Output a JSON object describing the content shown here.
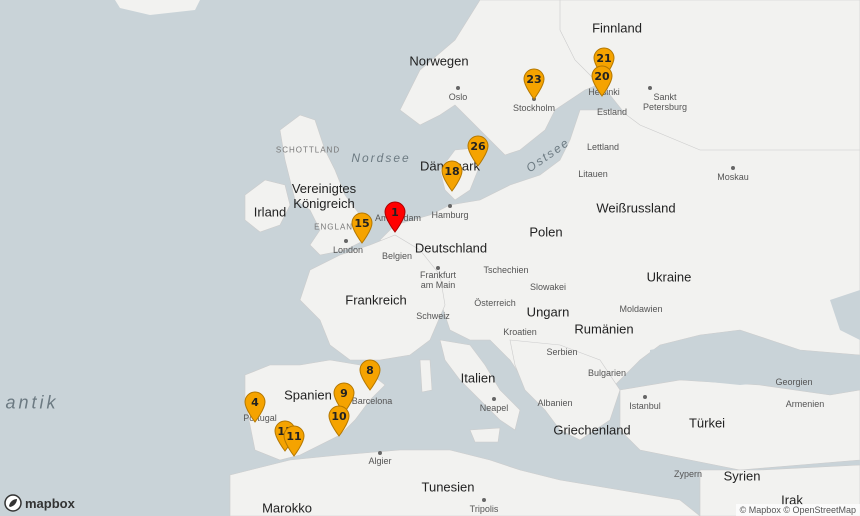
{
  "map": {
    "labels": {
      "finnland": "Finnland",
      "norwegen": "Norwegen",
      "oslo": "Oslo",
      "stockholm": "Stockholm",
      "helsinki": "Helsinki",
      "sankt_petersburg": "Sankt\nPetersburg",
      "estland": "Estland",
      "lettland": "Lettland",
      "litauen": "Litauen",
      "moskau": "Moskau",
      "schottland": "SCHOTTLAND",
      "nordsee": "Nordsee",
      "daenemark": "Dänemark",
      "ostsee": "Ostsee",
      "vereinigtes_koenigreich": "Vereinigtes\nKönigreich",
      "irland": "Irland",
      "england": "ENGLAND",
      "london": "London",
      "amsterdam": "Amsterdam",
      "hamburg": "Hamburg",
      "deutschland": "Deutschland",
      "polen": "Polen",
      "weissrussland": "Weißrussland",
      "belgien": "Belgien",
      "frankfurt": "Frankfurt\nam Main",
      "tschechien": "Tschechien",
      "slowakei": "Slowakei",
      "ukraine": "Ukraine",
      "frankreich": "Frankreich",
      "oesterreich": "Österreich",
      "schweiz": "Schweiz",
      "ungarn": "Ungarn",
      "moldawien": "Moldawien",
      "rumaenien": "Rumänien",
      "kroatien": "Kroatien",
      "serbien": "Serbien",
      "italien": "Italien",
      "bulgarien": "Bulgarien",
      "spanien": "Spanien",
      "barcelona": "Barcelona",
      "portugal": "Portugal",
      "atlantik": "antik",
      "neapel": "Neapel",
      "albanien": "Albanien",
      "istanbul": "Istanbul",
      "georgien": "Georgien",
      "armenien": "Armenien",
      "griechenland": "Griechenland",
      "tuerkei": "Türkei",
      "algier": "Algier",
      "tunesien": "Tunesien",
      "syrien": "Syrien",
      "zypern": "Zypern",
      "marokko": "Marokko",
      "tripolis": "Tripolis",
      "irak": "Irak"
    },
    "markers": [
      {
        "id": "m1",
        "label": "1",
        "color": "#ff0000"
      },
      {
        "id": "m4",
        "label": "4",
        "color": "#f5a300"
      },
      {
        "id": "m8",
        "label": "8",
        "color": "#f5a300"
      },
      {
        "id": "m9",
        "label": "9",
        "color": "#f5a300"
      },
      {
        "id": "m10",
        "label": "10",
        "color": "#f5a300"
      },
      {
        "id": "m11a",
        "label": "11",
        "color": "#f5a300"
      },
      {
        "id": "m11",
        "label": "11",
        "color": "#f5a300"
      },
      {
        "id": "m15",
        "label": "15",
        "color": "#f5a300"
      },
      {
        "id": "m18",
        "label": "18",
        "color": "#f5a300"
      },
      {
        "id": "m20",
        "label": "20",
        "color": "#f5a300"
      },
      {
        "id": "m21",
        "label": "21",
        "color": "#f5a300"
      },
      {
        "id": "m23",
        "label": "23",
        "color": "#f5a300"
      },
      {
        "id": "m26",
        "label": "26",
        "color": "#f5a300"
      }
    ],
    "colors": {
      "land": "#f2f2f0",
      "water": "#c9d3d8",
      "border": "#b9b9b9"
    }
  },
  "logo": {
    "text": "mapbox"
  },
  "attribution": "© Mapbox © OpenStreetMap"
}
